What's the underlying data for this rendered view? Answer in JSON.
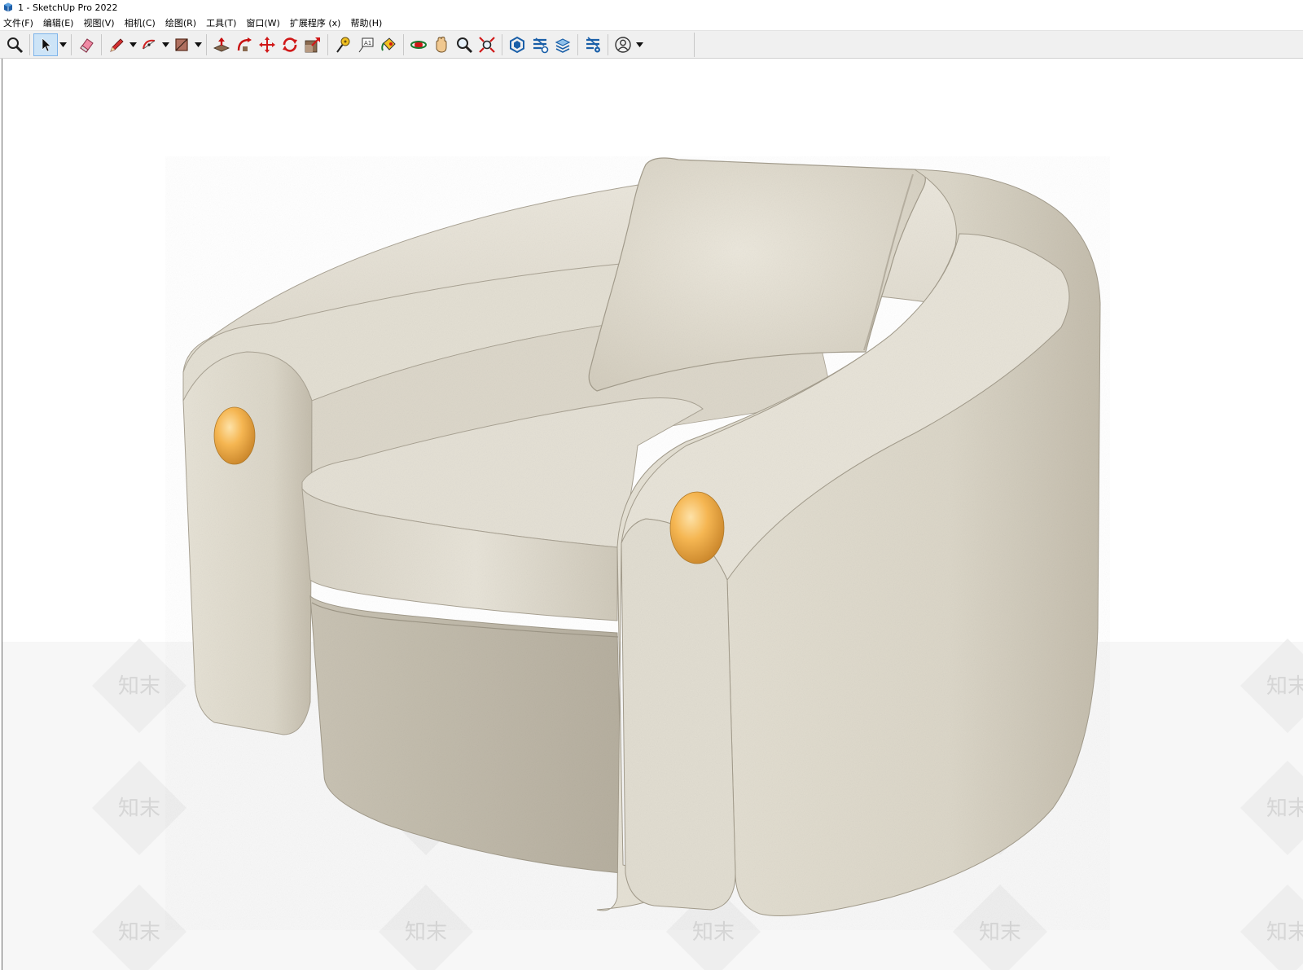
{
  "window": {
    "title": "1 - SketchUp Pro 2022"
  },
  "menu": {
    "items": [
      {
        "label": "文件(F)"
      },
      {
        "label": "编辑(E)"
      },
      {
        "label": "视图(V)"
      },
      {
        "label": "相机(C)"
      },
      {
        "label": "绘图(R)"
      },
      {
        "label": "工具(T)"
      },
      {
        "label": "窗口(W)"
      },
      {
        "label": "扩展程序 (x)"
      },
      {
        "label": "帮助(H)"
      }
    ]
  },
  "toolbar": {
    "tools": [
      {
        "icon": "zoom-window-icon"
      },
      {
        "icon": "select-arrow-icon",
        "active": true
      },
      {
        "icon": "eraser-icon"
      },
      {
        "icon": "pencil-line-icon"
      },
      {
        "icon": "arc-icon"
      },
      {
        "icon": "rectangle-shape-icon"
      },
      {
        "icon": "push-pull-icon"
      },
      {
        "icon": "follow-me-icon"
      },
      {
        "icon": "move-icon"
      },
      {
        "icon": "rotate-icon"
      },
      {
        "icon": "scale-icon"
      },
      {
        "icon": "tape-measure-icon"
      },
      {
        "icon": "text-icon"
      },
      {
        "icon": "paint-bucket-icon"
      },
      {
        "icon": "orbit-icon"
      },
      {
        "icon": "pan-hand-icon"
      },
      {
        "icon": "zoom-icon"
      },
      {
        "icon": "zoom-extents-icon"
      },
      {
        "icon": "warehouse-icon"
      },
      {
        "icon": "extension-warehouse-icon"
      },
      {
        "icon": "layout-icon"
      },
      {
        "icon": "extension-manager-icon"
      },
      {
        "icon": "user-account-icon"
      }
    ]
  },
  "viewport": {
    "watermark": "知末",
    "colors": {
      "upholstery": "#e4dfd3",
      "upholstery_shadow": "#b8b2a4",
      "brass_knob": "#f2b04c"
    }
  }
}
